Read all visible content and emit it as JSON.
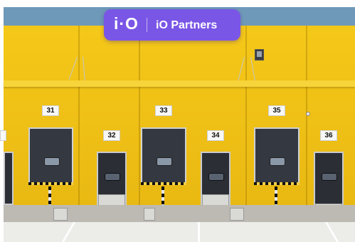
{
  "brand": {
    "logo_mark": "i·O",
    "name": "iO Partners",
    "badge_color": "#7a56e6"
  },
  "photo": {
    "subject": "loading-docks",
    "wall_color": "#f0c116",
    "dock_numbers_upper": [
      "31",
      "33",
      "35"
    ],
    "dock_numbers_lower": [
      "32",
      "34",
      "36"
    ]
  }
}
